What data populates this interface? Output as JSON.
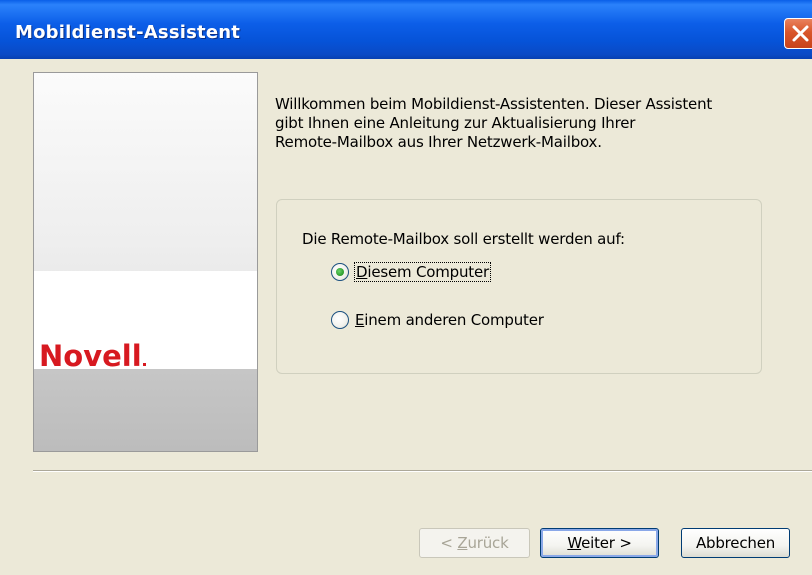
{
  "window": {
    "title": "Mobildienst-Assistent"
  },
  "intro_text": [
    "Willkommen beim Mobildienst-Assistenten. Dieser Assistent",
    "gibt Ihnen eine Anleitung zur Aktualisierung Ihrer",
    "Remote-Mailbox aus Ihrer Netzwerk-Mailbox."
  ],
  "logo": {
    "text": "Novell"
  },
  "location_group": {
    "label": "Die Remote-Mailbox soll erstellt werden auf:",
    "options": [
      {
        "mnemonic": "D",
        "rest": "iesem Computer",
        "checked": true
      },
      {
        "mnemonic": "E",
        "rest": "inem anderen Computer",
        "checked": false
      }
    ]
  },
  "buttons": {
    "back": {
      "prefix": "< ",
      "mnemonic": "Z",
      "rest": "urück",
      "enabled": false
    },
    "next": {
      "mnemonic": "W",
      "rest": "eiter >",
      "default": true
    },
    "cancel": {
      "label": "Abbrechen"
    }
  },
  "colors": {
    "titlebar": "#0a5fe8",
    "close_button": "#d9562b",
    "logo": "#d71920",
    "dialog_background": "#ece9d8"
  },
  "icons": {
    "close": "close-x-icon"
  }
}
